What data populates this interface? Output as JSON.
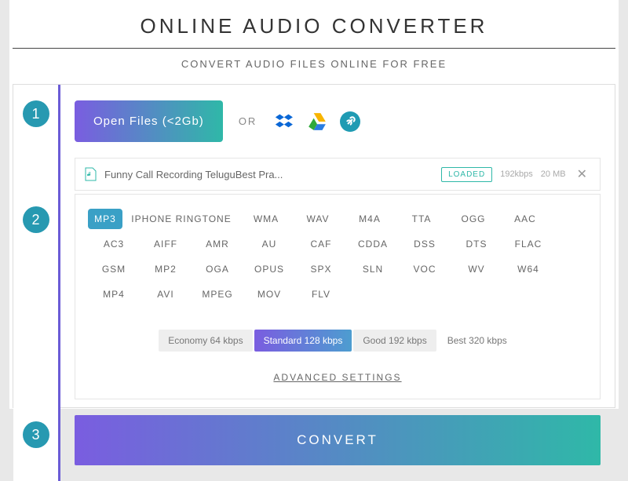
{
  "header": {
    "title": "ONLINE AUDIO CONVERTER",
    "subtitle": "CONVERT AUDIO FILES ONLINE FOR FREE"
  },
  "steps": {
    "one": "1",
    "two": "2",
    "three": "3"
  },
  "open": {
    "button_label": "Open Files (<2Gb)",
    "or_label": "OR"
  },
  "file": {
    "name": "Funny Call Recording TeluguBest Pra...",
    "status": "LOADED",
    "bitrate": "192kbps",
    "size": "20 MB"
  },
  "formats": [
    "MP3",
    "IPHONE RINGTONE",
    "WMA",
    "WAV",
    "M4A",
    "TTA",
    "OGG",
    "AAC",
    "AC3",
    "AIFF",
    "AMR",
    "AU",
    "CAF",
    "CDDA",
    "DSS",
    "DTS",
    "FLAC",
    "GSM",
    "MP2",
    "OGA",
    "OPUS",
    "SPX",
    "SLN",
    "VOC",
    "WV",
    "W64",
    "MP4",
    "AVI",
    "MPEG",
    "MOV",
    "FLV"
  ],
  "quality": {
    "options": [
      "Economy 64 kbps",
      "Standard 128 kbps",
      "Good 192 kbps",
      "Best 320 kbps"
    ],
    "active_index": 1
  },
  "advanced_label": "ADVANCED SETTINGS",
  "convert_label": "CONVERT"
}
